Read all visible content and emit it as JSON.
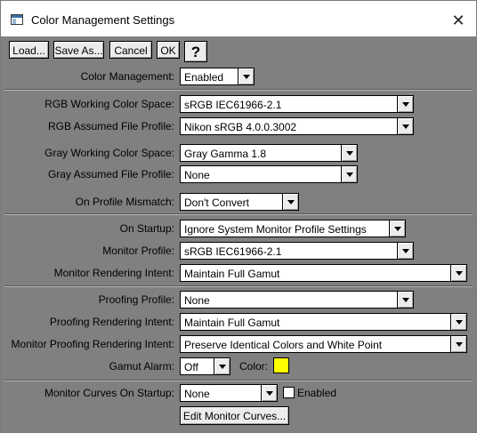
{
  "window": {
    "title": "Color Management Settings",
    "close_glyph": "✕"
  },
  "toolbar": {
    "load_label": "Load...",
    "save_as_label": "Save As...",
    "cancel_label": "Cancel",
    "ok_label": "OK",
    "help_label": "?"
  },
  "general": {
    "color_management_label": "Color Management:",
    "color_management_value": "Enabled"
  },
  "working_spaces": {
    "rgb_working_label": "RGB Working Color Space:",
    "rgb_working_value": "sRGB IEC61966-2.1",
    "rgb_assumed_label": "RGB Assumed File Profile:",
    "rgb_assumed_value": "Nikon sRGB 4.0.0.3002",
    "gray_working_label": "Gray Working Color Space:",
    "gray_working_value": "Gray Gamma 1.8",
    "gray_assumed_label": "Gray Assumed File Profile:",
    "gray_assumed_value": "None",
    "mismatch_label": "On Profile Mismatch:",
    "mismatch_value": "Don't Convert"
  },
  "monitor": {
    "startup_label": "On Startup:",
    "startup_value": "Ignore System Monitor Profile Settings",
    "profile_label": "Monitor Profile:",
    "profile_value": "sRGB IEC61966-2.1",
    "intent_label": "Monitor Rendering Intent:",
    "intent_value": "Maintain Full Gamut"
  },
  "proofing": {
    "profile_label": "Proofing Profile:",
    "profile_value": "None",
    "intent_label": "Proofing Rendering Intent:",
    "intent_value": "Maintain Full Gamut",
    "monitor_intent_label": "Monitor Proofing Rendering Intent:",
    "monitor_intent_value": "Preserve Identical Colors and White Point",
    "gamut_alarm_label": "Gamut Alarm:",
    "gamut_alarm_value": "Off",
    "color_label": "Color:",
    "alarm_color": "#ffff00"
  },
  "curves": {
    "startup_label": "Monitor Curves On Startup:",
    "startup_value": "None",
    "enabled_label": "Enabled",
    "enabled_checked": false,
    "edit_button_label": "Edit Monitor Curves..."
  }
}
